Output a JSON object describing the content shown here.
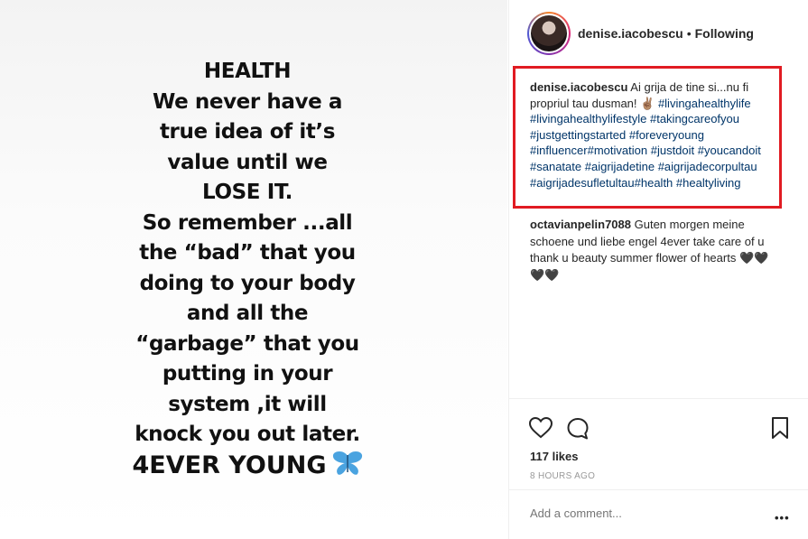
{
  "post_image": {
    "lines": [
      "HEALTH",
      "We never have a",
      "true idea of it’s",
      "value until we",
      "LOSE IT.",
      "So remember ...all",
      "the “bad” that you",
      "doing to your body",
      "and all the",
      "“garbage” that you",
      "putting in your",
      "system ,it will",
      "knock you out later."
    ],
    "last_line": "4EVER YOUNG"
  },
  "header": {
    "username": "denise.iacobescu",
    "separator": "•",
    "follow_status": "Following"
  },
  "caption": {
    "author": "denise.iacobescu",
    "text": "Ai grija de tine si...nu fi propriul tau dusman! ✌🏽",
    "hashtags": [
      "#livingahealthylife",
      "#livingahealthylifestyle",
      "#takingcareofyou",
      "#justgettingstarted",
      "#foreveryoung",
      "#influencer",
      "#motivation",
      "#justdoit",
      "#youcandoit",
      "#sanatate",
      "#aigrijadetine",
      "#aigrijadecorpultau",
      "#aigrijadesufletultau",
      "#health",
      "#healtyliving"
    ],
    "highlight_color": "#e11b22"
  },
  "comments": [
    {
      "author": "octavianpelin7088",
      "text": "Guten morgen meine schoene und liebe engel 4ever take care of u thank u beauty summer flower of hearts 🖤🖤🖤🖤"
    }
  ],
  "actions": {
    "like_icon": "heart-icon",
    "comment_icon": "comment-icon",
    "save_icon": "bookmark-icon"
  },
  "likes": "117 likes",
  "timestamp": "8 HOURS AGO",
  "add_comment_placeholder": "Add a comment...",
  "more_options": "•••"
}
